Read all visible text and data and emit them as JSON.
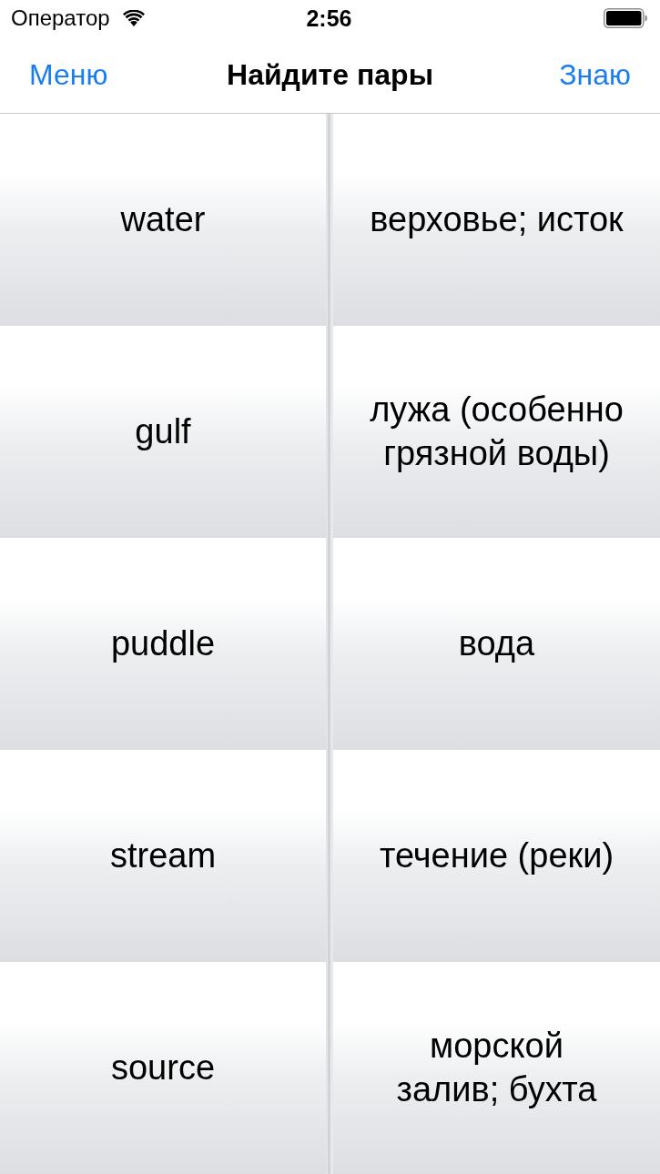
{
  "status_bar": {
    "carrier": "Оператор",
    "time": "2:56"
  },
  "nav_bar": {
    "left_button": "Меню",
    "title": "Найдите пары",
    "right_button": "Знаю"
  },
  "rows": [
    {
      "left": "water",
      "right": "верховье; исток"
    },
    {
      "left": "gulf",
      "right": "лужа (особенно грязной воды)"
    },
    {
      "left": "puddle",
      "right": "вода"
    },
    {
      "left": "stream",
      "right": "течение (реки)"
    },
    {
      "left": "source",
      "right": "морской залив; бухта"
    }
  ]
}
